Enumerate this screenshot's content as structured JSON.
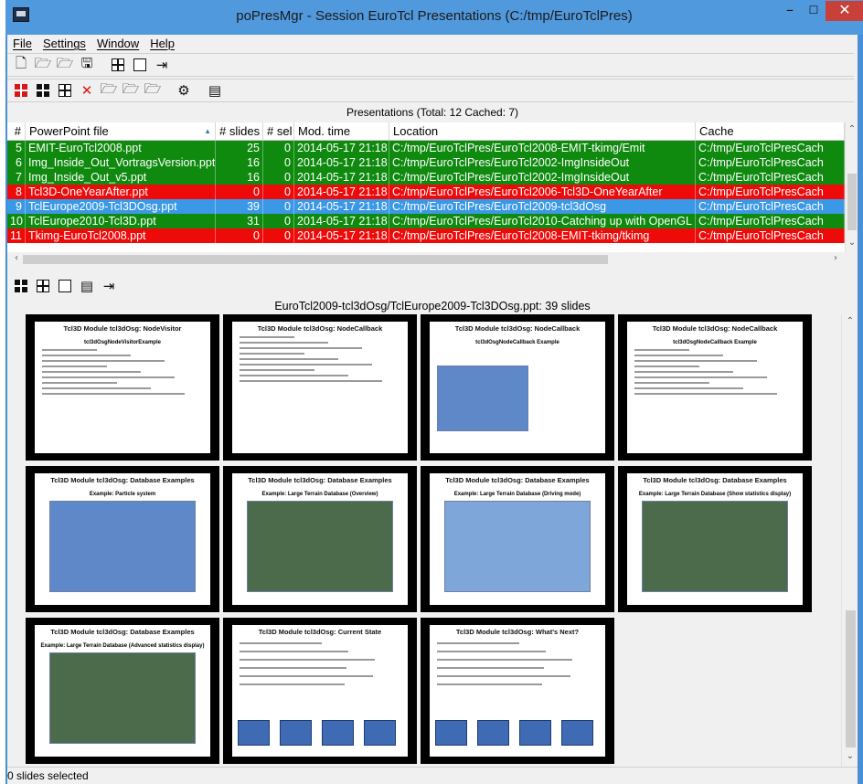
{
  "window": {
    "title": "poPresMgr - Session EuroTcl Presentations (C:/tmp/EuroTclPres)",
    "minimize": "–",
    "maximize": "☐",
    "close": "✕"
  },
  "menu": {
    "file": "File",
    "settings": "Settings",
    "window": "Window",
    "help": "Help"
  },
  "toolbar1": [
    "new-icon",
    "open-template-icon",
    "open-folder-icon",
    "save-icon",
    "grid-icon",
    "single-view-icon",
    "exit-icon"
  ],
  "toolbar2": [
    "select-all-icon",
    "grid-filled-icon",
    "grid-icon",
    "delete-icon",
    "open-icon",
    "open-alt-icon",
    "open-alt2-icon",
    "scan-icon",
    "powerpoint-icon"
  ],
  "toolbar3": [
    "select-all-icon",
    "grid-icon",
    "single-view-icon",
    "list-icon",
    "exit-icon"
  ],
  "presentations": {
    "header": "Presentations (Total: 12 Cached: 7)",
    "columns": [
      "#",
      "PowerPoint file",
      "# slides",
      "# sel",
      "Mod. time",
      "Location",
      "Cache"
    ],
    "rows": [
      {
        "num": "5",
        "file": "EMIT-EuroTcl2008.ppt",
        "slides": "25",
        "sel": "0",
        "mod": "2014-05-17 21:18",
        "loc": "C:/tmp/EuroTclPres/EuroTcl2008-EMIT-tkimg/Emit",
        "cache": "C:/tmp/EuroTclPresCach",
        "status": "green"
      },
      {
        "num": "6",
        "file": "Img_Inside_Out_VortragsVersion.ppt",
        "slides": "16",
        "sel": "0",
        "mod": "2014-05-17 21:18",
        "loc": "C:/tmp/EuroTclPres/EuroTcl2002-ImgInsideOut",
        "cache": "C:/tmp/EuroTclPresCach",
        "status": "green"
      },
      {
        "num": "7",
        "file": "Img_Inside_Out_v5.ppt",
        "slides": "16",
        "sel": "0",
        "mod": "2014-05-17 21:18",
        "loc": "C:/tmp/EuroTclPres/EuroTcl2002-ImgInsideOut",
        "cache": "C:/tmp/EuroTclPresCach",
        "status": "green"
      },
      {
        "num": "8",
        "file": "Tcl3D-OneYearAfter.ppt",
        "slides": "0",
        "sel": "0",
        "mod": "2014-05-17 21:18",
        "loc": "C:/tmp/EuroTclPres/EuroTcl2006-Tcl3D-OneYearAfter",
        "cache": "C:/tmp/EuroTclPresCach",
        "status": "red"
      },
      {
        "num": "9",
        "file": "TclEurope2009-Tcl3DOsg.ppt",
        "slides": "39",
        "sel": "0",
        "mod": "2014-05-17 21:18",
        "loc": "C:/tmp/EuroTclPres/EuroTcl2009-tcl3dOsg",
        "cache": "C:/tmp/EuroTclPresCach",
        "status": "selected"
      },
      {
        "num": "10",
        "file": "TclEurope2010-Tcl3D.ppt",
        "slides": "31",
        "sel": "0",
        "mod": "2014-05-17 21:18",
        "loc": "C:/tmp/EuroTclPres/EuroTcl2010-Catching up with OpenGL",
        "cache": "C:/tmp/EuroTclPresCach",
        "status": "green"
      },
      {
        "num": "11",
        "file": "Tkimg-EuroTcl2008.ppt",
        "slides": "0",
        "sel": "0",
        "mod": "2014-05-17 21:18",
        "loc": "C:/tmp/EuroTclPres/EuroTcl2008-EMIT-tkimg/tkimg",
        "cache": "C:/tmp/EuroTclPresCach",
        "status": "red"
      }
    ]
  },
  "slides_panel": {
    "title": "EuroTcl2009-tcl3dOsg/TclEurope2009-Tcl3DOsg.ppt: 39 slides",
    "slides": [
      {
        "title": "Tcl3D Module tcl3dOsg: NodeVisitor",
        "subtitle": "tcl3dOsgNodeVisitorExample",
        "kind": "text"
      },
      {
        "title": "Tcl3D Module tcl3dOsg: NodeCallback",
        "subtitle": "",
        "kind": "text"
      },
      {
        "title": "Tcl3D Module tcl3dOsg: NodeCallback",
        "subtitle": "tcl3dOsgNodeCallback Example",
        "kind": "shot-small"
      },
      {
        "title": "Tcl3D Module tcl3dOsg: NodeCallback",
        "subtitle": "tcl3dOsgNodeCallback Example",
        "kind": "text"
      },
      {
        "title": "Tcl3D Module tcl3dOsg: Database Examples",
        "subtitle": "Example: Particle system",
        "kind": "shot"
      },
      {
        "title": "Tcl3D Module tcl3dOsg: Database Examples",
        "subtitle": "Example: Large Terrain Database (Overview)",
        "kind": "shot"
      },
      {
        "title": "Tcl3D Module tcl3dOsg: Database Examples",
        "subtitle": "Example: Large Terrain Database (Driving mode)",
        "kind": "shot"
      },
      {
        "title": "Tcl3D Module tcl3dOsg: Database Examples",
        "subtitle": "Example: Large Terrain Database (Show statistics display)",
        "kind": "shot"
      },
      {
        "title": "Tcl3D Module tcl3dOsg: Database Examples",
        "subtitle": "Example: Large Terrain Database (Advanced statistics display)",
        "kind": "shot"
      },
      {
        "title": "Tcl3D Module tcl3dOsg: Current State",
        "subtitle": "",
        "kind": "tiles"
      },
      {
        "title": "Tcl3D Module tcl3dOsg: What's Next?",
        "subtitle": "",
        "kind": "tiles"
      }
    ]
  },
  "status": "0 slides selected",
  "colors": {
    "ok": "#0f8a0f",
    "missing": "#ef0a0a",
    "selected": "#3a98e6"
  }
}
